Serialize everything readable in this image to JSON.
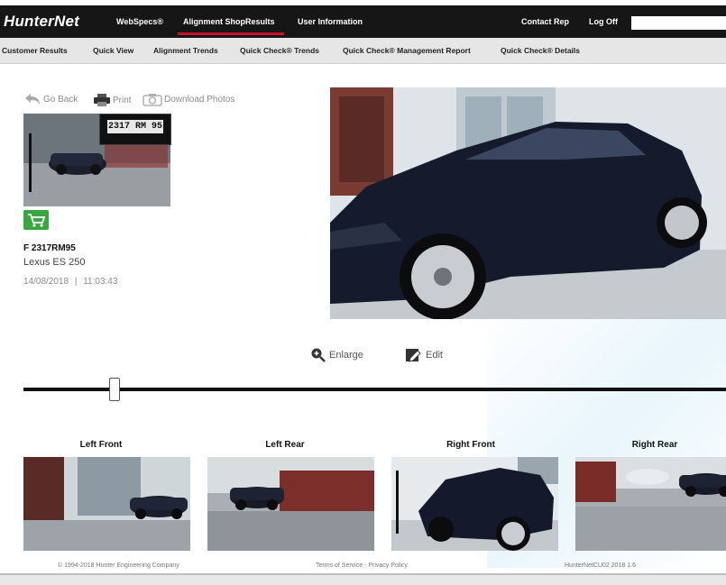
{
  "header": {
    "logo": "HunterNet",
    "nav": [
      {
        "label": "WebSpecs®"
      },
      {
        "label": "Alignment ShopResults"
      },
      {
        "label": "User Information"
      }
    ],
    "right_nav": [
      {
        "label": "Contact Rep"
      },
      {
        "label": "Log Off"
      }
    ],
    "search": {
      "value": "",
      "placeholder": ""
    },
    "active_color": "#c8102e"
  },
  "subnav": {
    "items": [
      {
        "label": "Customer Results"
      },
      {
        "label": "Quick View"
      },
      {
        "label": "Alignment Trends"
      },
      {
        "label": "Quick Check® Trends"
      },
      {
        "label": "Quick Check® Management Report"
      },
      {
        "label": "Quick Check® Details"
      }
    ]
  },
  "actions": {
    "go_back": "Go Back",
    "print": "Print",
    "download": "Download Photos"
  },
  "vehicle": {
    "plate_id": "F 2317RM95",
    "plate_overlay": "2317 RM 95",
    "model": "Lexus ES 250",
    "date": "14/08/2018",
    "separator": "|",
    "time": "11:03:43",
    "badge_icon": "cart-icon",
    "badge_color": "#3aa63f"
  },
  "photo_tools": {
    "enlarge": "Enlarge",
    "edit": "Edit"
  },
  "slider": {
    "position_fraction": 0.13
  },
  "thumbnails": [
    {
      "label": "Left Front"
    },
    {
      "label": "Left Rear"
    },
    {
      "label": "Right Front"
    },
    {
      "label": "Right Rear"
    }
  ],
  "footer": {
    "copyright": "© 1994-2018 Hunter Engineering Company",
    "terms": "Terms of Service",
    "dash": " - ",
    "privacy": "Privacy Policy",
    "version": "HunterNetCU02 2018 1.6"
  }
}
